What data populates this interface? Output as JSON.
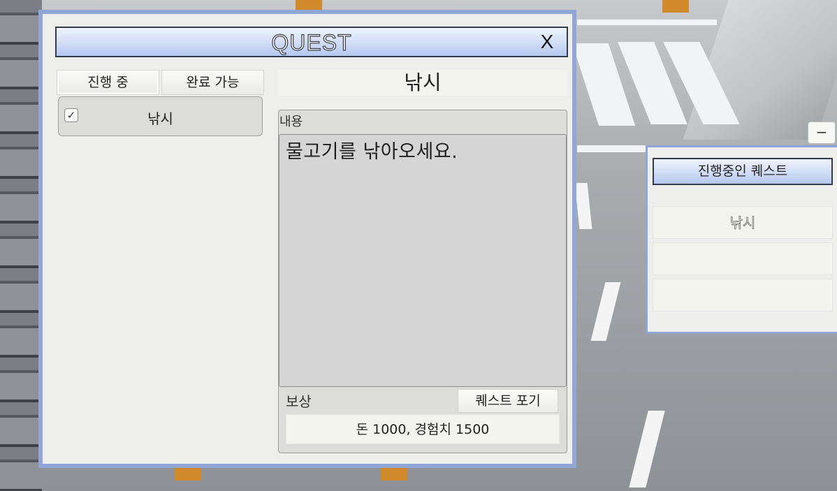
{
  "quest_window": {
    "title": "QUEST",
    "close_label": "X",
    "tabs": [
      {
        "label": "진행 중",
        "active": true
      },
      {
        "label": "완료 가능",
        "active": false
      }
    ],
    "quest_list": [
      {
        "label": "낚시",
        "checked": true,
        "check_glyph": "✓"
      }
    ],
    "detail": {
      "title": "낚시",
      "content_label": "내용",
      "content_text": "물고기를 낚아오세요.",
      "reward_label": "보상",
      "abandon_button_label": "퀘스트 포기",
      "reward_text": "돈 1000, 경험치 1500"
    }
  },
  "tracker": {
    "minimize_label": "−",
    "header_label": "진행중인 퀘스트",
    "slots": [
      "낚시",
      "",
      ""
    ]
  },
  "colors": {
    "window_border": "#90a6d6",
    "panel_bg": "#eeeeec",
    "title_gradient_bottom": "#b4c7ef"
  }
}
